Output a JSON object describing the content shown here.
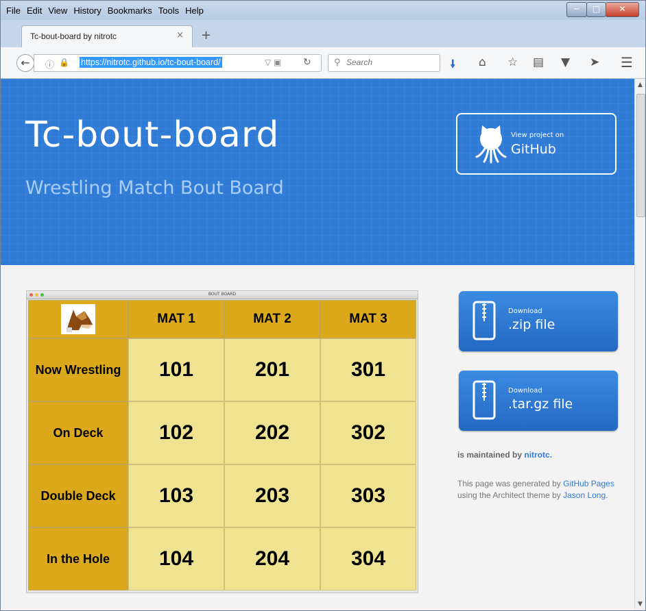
{
  "menu": [
    "File",
    "Edit",
    "View",
    "History",
    "Bookmarks",
    "Tools",
    "Help"
  ],
  "tab": {
    "title": "Tc-bout-board by nitrotc",
    "close": "×",
    "new": "+"
  },
  "nav": {
    "url": "https://nitrotc.github.io/tc-bout-board/",
    "search_placeholder": "Search"
  },
  "header": {
    "title": "Tc-bout-board",
    "subtitle": "Wrestling Match Bout Board",
    "github_small": "View project on",
    "github_big": "GitHub"
  },
  "board": {
    "window_title": "BOUT BOARD",
    "columns": [
      "MAT 1",
      "MAT 2",
      "MAT 3"
    ],
    "rows": [
      {
        "label": "Now Wrestling",
        "values": [
          "101",
          "201",
          "301"
        ]
      },
      {
        "label": "On Deck",
        "values": [
          "102",
          "202",
          "302"
        ]
      },
      {
        "label": "Double Deck",
        "values": [
          "103",
          "203",
          "303"
        ]
      },
      {
        "label": "In the Hole",
        "values": [
          "104",
          "204",
          "304"
        ]
      }
    ]
  },
  "downloads": [
    {
      "small": "Download",
      "big": ".zip file"
    },
    {
      "small": "Download",
      "big": ".tar.gz file"
    }
  ],
  "sidebar": {
    "maintained_prefix": "is maintained by",
    "maintainer": "nitrotc.",
    "gen_1": "This page was generated by",
    "gen_link1": "GitHub Pages",
    "gen_2": "using the Architect theme by",
    "gen_link2": "Jason Long",
    "gen_3": "."
  },
  "colors": {
    "header_blue": "#2f7bd6",
    "mat_gold": "#dca91c",
    "cell_yellow": "#efe290"
  }
}
